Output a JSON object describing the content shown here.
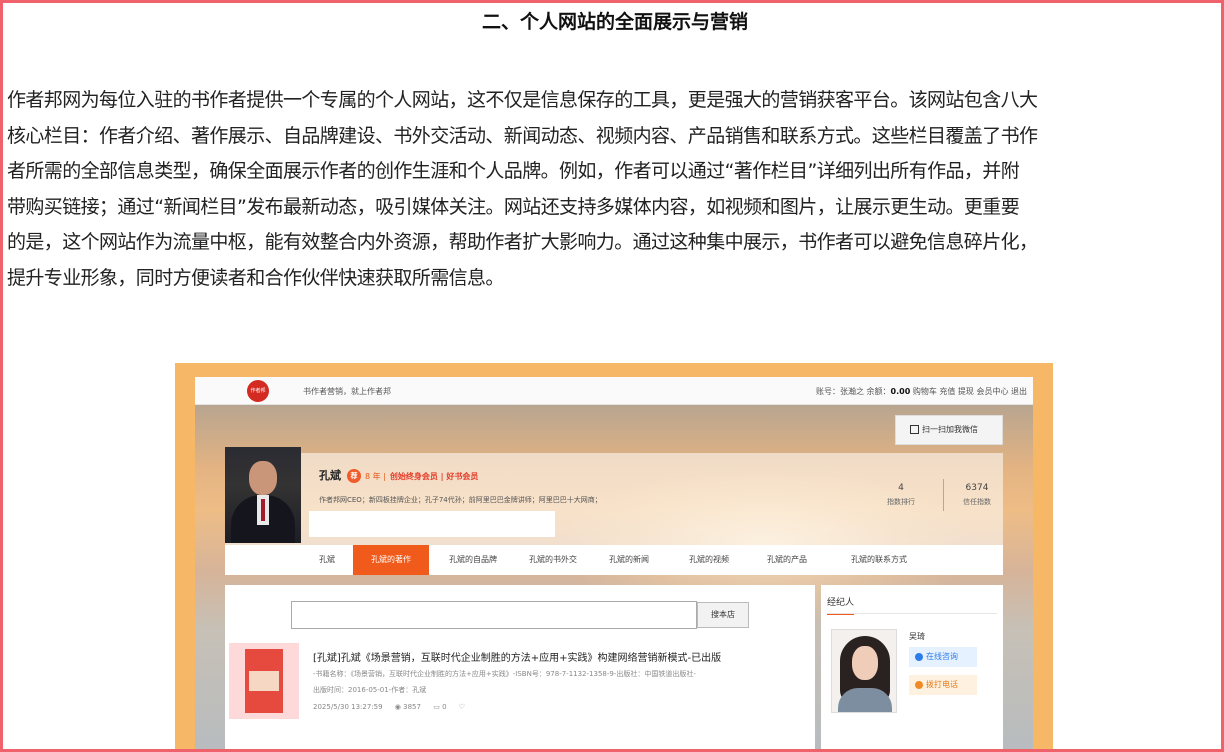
{
  "heading": "二、个人网站的全面展示与营销",
  "paragraph_lines": [
    "作者邦网为每位入驻的书作者提供一个专属的个人网站，这不仅是信息保存的工具，更是强大的营销获客平台。该网站包含八大",
    "核心栏目：作者介绍、著作展示、自品牌建设、书外交活动、新闻动态、视频内容、产品销售和联系方式。这些栏目覆盖了书作",
    "者所需的全部信息类型，确保全面展示作者的创作生涯和个人品牌。例如，作者可以通过“著作栏目”详细列出所有作品，并附",
    "带购买链接；通过“新闻栏目”发布最新动态，吸引媒体关注。网站还支持多媒体内容，如视频和图片，让展示更生动。更重要",
    "的是，这个网站作为流量中枢，能有效整合内外资源，帮助作者扩大影响力。通过这种集中展示，书作者可以避免信息碎片化，",
    "提升专业形象，同时方便读者和合作伙伴快速获取所需信息。"
  ],
  "screenshot": {
    "topbar": {
      "logo_text": "作者邦",
      "slogan": "书作者营销，就上作者邦",
      "account_prefix": "账号：张瀚之  余额：",
      "balance": "0.00",
      "account_links": "购物车  充值  提现  会员中心  退出"
    },
    "qr_button": "扫一扫加我微信",
    "profile": {
      "name": "孔斌",
      "badge": "荐",
      "years": "8 年 |",
      "membership": "创始终身会员 | 好书会员",
      "description": "作者邦网CEO；新四板挂牌企业；孔子74代孙；前阿里巴巴金牌讲师；阿里巴巴十大网商；",
      "stats": [
        {
          "value": "4",
          "label": "指数排行"
        },
        {
          "value": "6374",
          "label": "信任指数"
        }
      ]
    },
    "nav": [
      {
        "label": "孔斌",
        "active": false
      },
      {
        "label": "孔斌的著作",
        "active": true
      },
      {
        "label": "孔斌的自品牌",
        "active": false
      },
      {
        "label": "孔斌的书外交",
        "active": false
      },
      {
        "label": "孔斌的新闻",
        "active": false
      },
      {
        "label": "孔斌的视频",
        "active": false
      },
      {
        "label": "孔斌的产品",
        "active": false
      },
      {
        "label": "孔斌的联系方式",
        "active": false
      }
    ],
    "search": {
      "placeholder": "",
      "button": "搜本店"
    },
    "book": {
      "title": "[孔斌]孔斌《场景营销，互联时代企业制胜的方法+应用+实践》构建网络营销新模式-已出版",
      "meta": "-书籍名称：《场景营销，互联时代企业制胜的方法+应用+实践》-ISBN号：978-7-1132-1358-9-出版社：中国铁道出版社-",
      "pub_date": "出版时间：2016-05-01-作者：孔斌",
      "timestamp": "2025/5/30 13:27:59",
      "views": "3857",
      "comments": "0"
    },
    "agent": {
      "title": "经纪人",
      "name": "吴琦",
      "consult": "在线咨询",
      "call": "拨打电话"
    }
  }
}
